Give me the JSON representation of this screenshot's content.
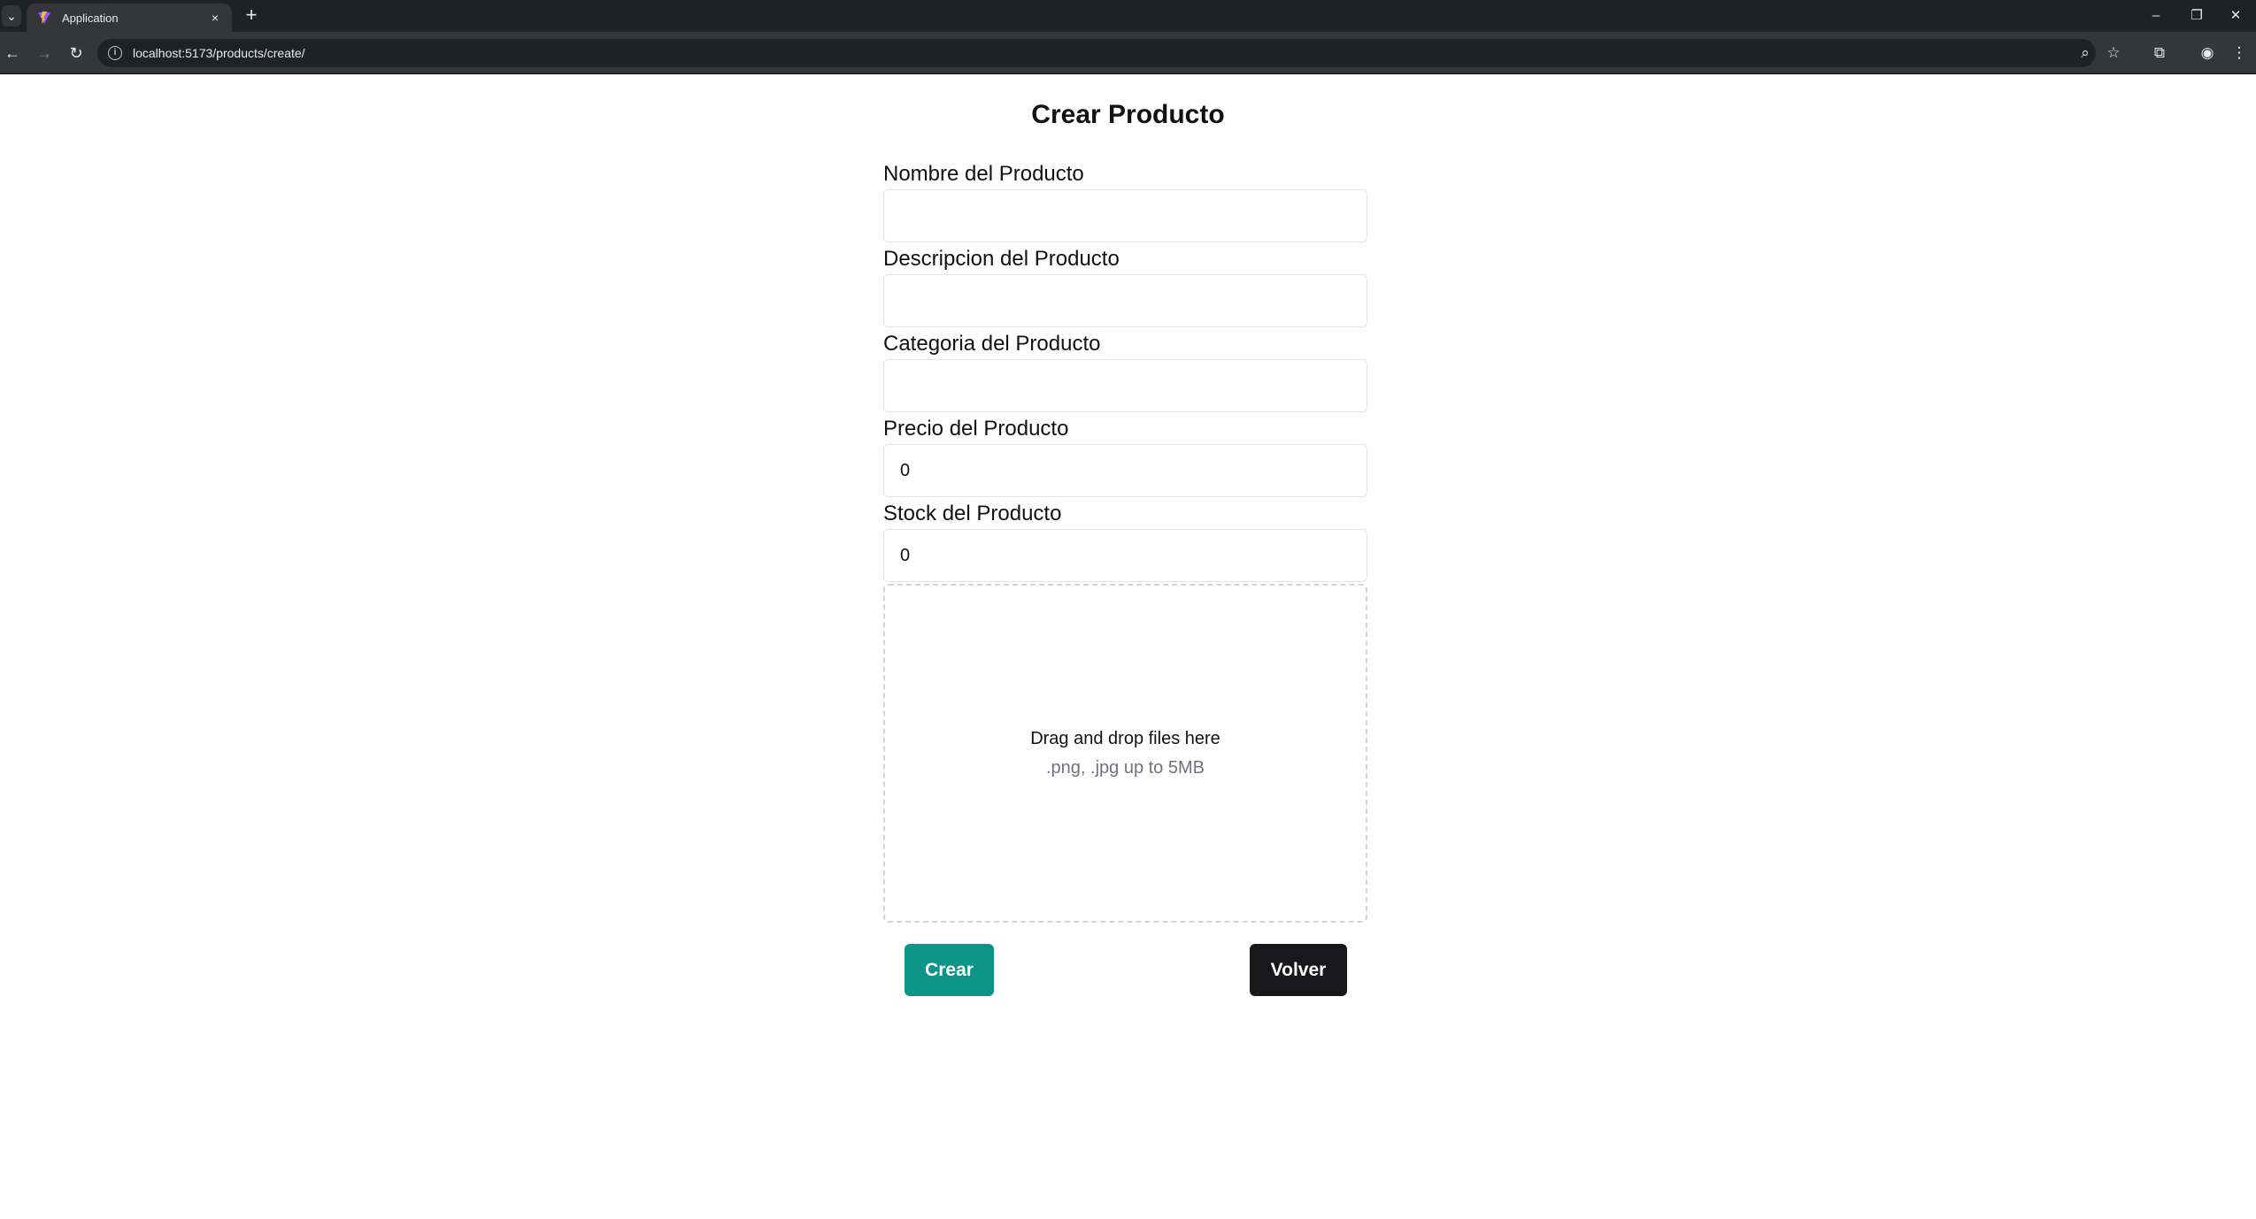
{
  "browser": {
    "tab_title": "Application",
    "tab_close": "×",
    "new_tab": "+",
    "url": "localhost:5173/products/create/",
    "window_controls": {
      "minimize": "–",
      "restore": "❐",
      "close": "✕"
    },
    "icons": [
      "back-icon",
      "forward-icon",
      "reload-icon",
      "info-icon",
      "zoom-icon",
      "star-icon",
      "extensions-icon",
      "profile-icon",
      "menu-icon"
    ]
  },
  "page": {
    "title": "Crear Producto",
    "fields": [
      {
        "label": "Nombre del Producto",
        "value": ""
      },
      {
        "label": "Descripcion del Producto",
        "value": ""
      },
      {
        "label": "Categoria del Producto",
        "value": ""
      },
      {
        "label": "Precio del Producto",
        "value": "0"
      },
      {
        "label": "Stock del Producto",
        "value": "0"
      }
    ],
    "dropzone": {
      "title": "Drag and drop files here",
      "subtitle": ".png, .jpg up to 5MB"
    },
    "buttons": {
      "create": "Crear",
      "back": "Volver"
    }
  },
  "colors": {
    "create_button": "#0d9488",
    "back_button": "#18181b",
    "chrome_dark": "#202124",
    "chrome_toolbar": "#35363a"
  }
}
